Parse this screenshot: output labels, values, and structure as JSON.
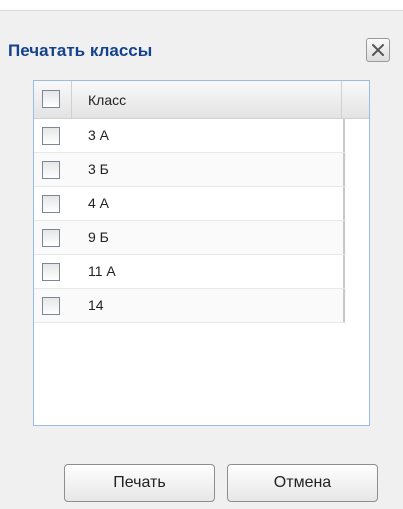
{
  "dialog": {
    "title": "Печатать классы",
    "close_icon": "close-icon"
  },
  "grid": {
    "header_label": "Класс",
    "rows": [
      {
        "label": "3 А",
        "checked": false
      },
      {
        "label": "3 Б",
        "checked": false
      },
      {
        "label": "4 А",
        "checked": false
      },
      {
        "label": "9 Б",
        "checked": false
      },
      {
        "label": "11 А",
        "checked": false
      },
      {
        "label": "14",
        "checked": false
      }
    ]
  },
  "buttons": {
    "print_label": "Печать",
    "cancel_label": "Отмена"
  },
  "colors": {
    "title": "#15428b",
    "panel_border": "#99bbe8",
    "dialog_background": "#f0f0f0"
  }
}
